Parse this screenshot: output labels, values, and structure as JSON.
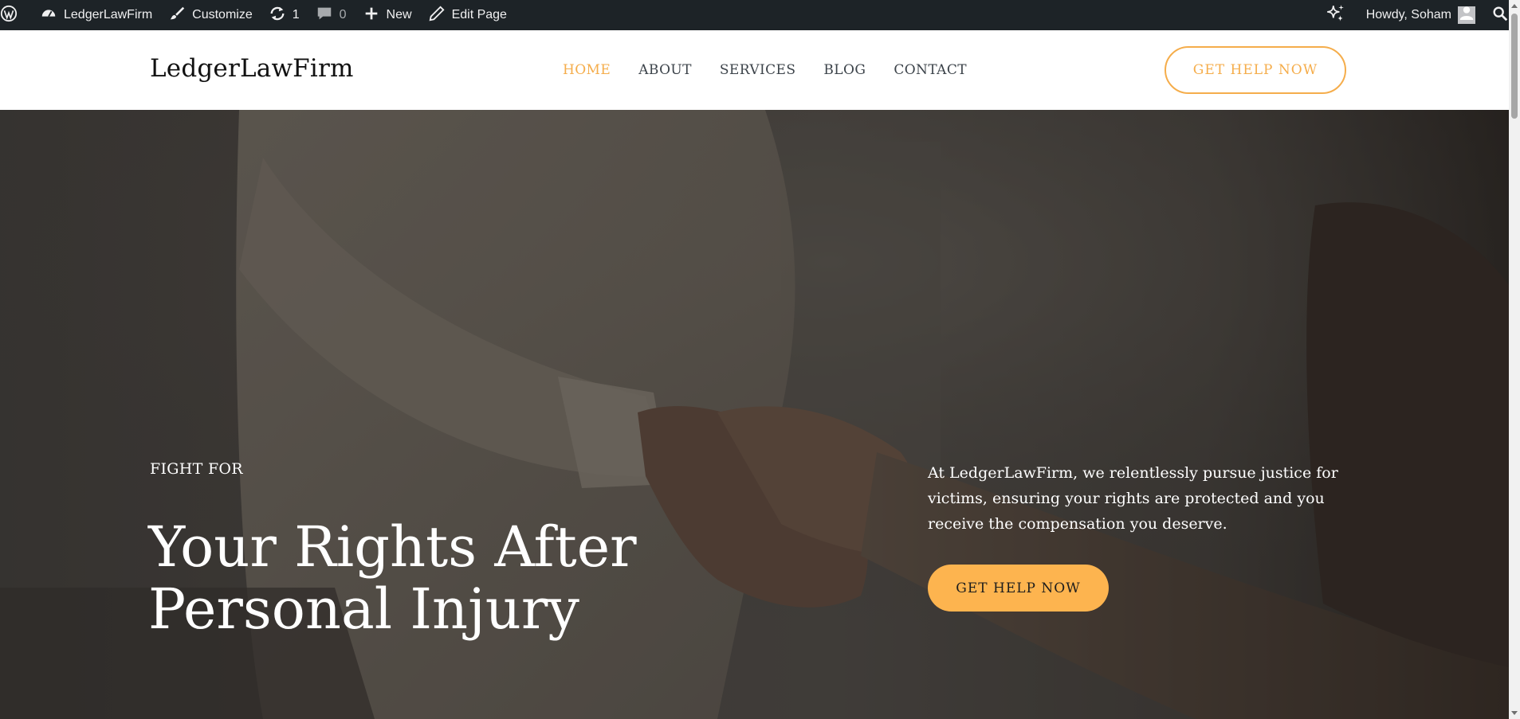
{
  "admin_bar": {
    "site_name": "LedgerLawFirm",
    "customize": "Customize",
    "updates_count": "1",
    "comments_count": "0",
    "new": "New",
    "edit_page": "Edit Page",
    "greeting": "Howdy, Soham"
  },
  "header": {
    "site_title": "LedgerLawFirm",
    "nav": [
      "HOME",
      "ABOUT",
      "SERVICES",
      "BLOG",
      "CONTACT"
    ],
    "active_nav": "HOME",
    "cta": "GET HELP NOW"
  },
  "hero": {
    "eyebrow": "FIGHT FOR",
    "heading": "Your Rights After Personal Injury",
    "copy": "At LedgerLawFirm, we relentlessly pursue justice for victims, ensuring your rights are protected and you receive the compensation you deserve.",
    "cta": "GET HELP NOW"
  },
  "colors": {
    "accent": "#f5ad4b",
    "admin_bar": "#1d2327"
  },
  "icons": [
    "wordpress-icon",
    "dashboard-icon",
    "brush-icon",
    "refresh-icon",
    "comment-icon",
    "plus-icon",
    "pencil-icon",
    "sparkle-icon",
    "user-icon",
    "search-icon"
  ]
}
